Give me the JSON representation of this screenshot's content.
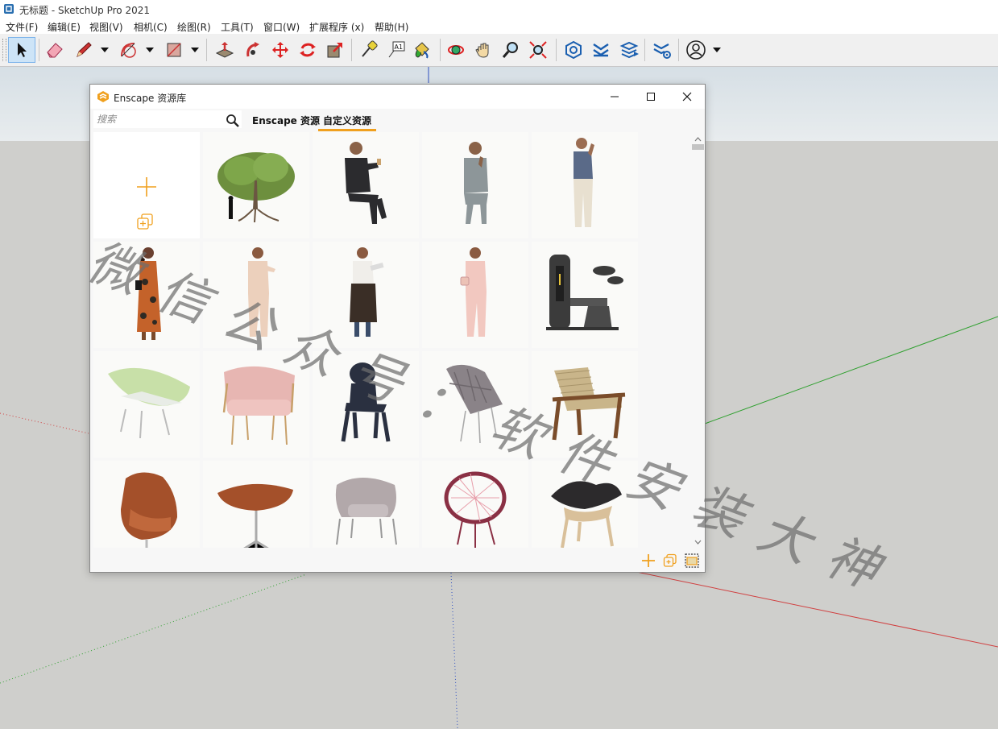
{
  "window": {
    "title": "无标题 - SketchUp Pro 2021"
  },
  "menu": [
    "文件(F)",
    "编辑(E)",
    "视图(V)",
    "相机(C)",
    "绘图(R)",
    "工具(T)",
    "窗口(W)",
    "扩展程序 (x)",
    "帮助(H)"
  ],
  "toolbar": {
    "tools": [
      "select-icon",
      "eraser-icon",
      "pencil-icon",
      "arc-icon",
      "rectangle-icon",
      "push-pull-icon",
      "follow-me-icon",
      "move-icon",
      "rotate-icon",
      "scale-icon",
      "tape-measure-icon",
      "text-icon",
      "paint-bucket-icon",
      "orbit-icon",
      "pan-icon",
      "zoom-icon",
      "zoom-extents-icon",
      "enscape-start-icon",
      "enscape-sync-icon",
      "enscape-assets-icon",
      "enscape-settings-icon",
      "account-icon"
    ],
    "text_tool_glyph": "A1"
  },
  "enscape": {
    "title": "Enscape 资源库",
    "search_placeholder": "搜索",
    "tabs": [
      "Enscape 资源",
      "自定义资源"
    ],
    "active_tab": "自定义资源",
    "assets": [
      "add-asset-tile",
      "tree",
      "man-seated-dark-suit",
      "man-seated-gray-suit",
      "man-standing-phone",
      "woman-floral-dress",
      "woman-beige-suit",
      "waitress-apron",
      "woman-pink-suit",
      "gym-machine",
      "green-lounge-chair",
      "pink-armchair",
      "black-ghost-chair",
      "gray-leaf-chair",
      "rope-armchair",
      "egg-chair",
      "egg-ottoman",
      "gray-womb-chair",
      "pink-acapulco-chair",
      "shell-chair"
    ]
  },
  "watermark": {
    "line1": [
      "微",
      "信",
      "公",
      "众",
      "号"
    ],
    "separator": "：",
    "line2": [
      "软",
      "件",
      "安",
      "装",
      "大",
      "神"
    ]
  },
  "colors": {
    "accent": "#f0a01e",
    "toolbar_selected": "#cde4f7",
    "axis_red": "#d04040",
    "axis_green": "#2fa02f",
    "axis_blue": "#3050c0"
  }
}
